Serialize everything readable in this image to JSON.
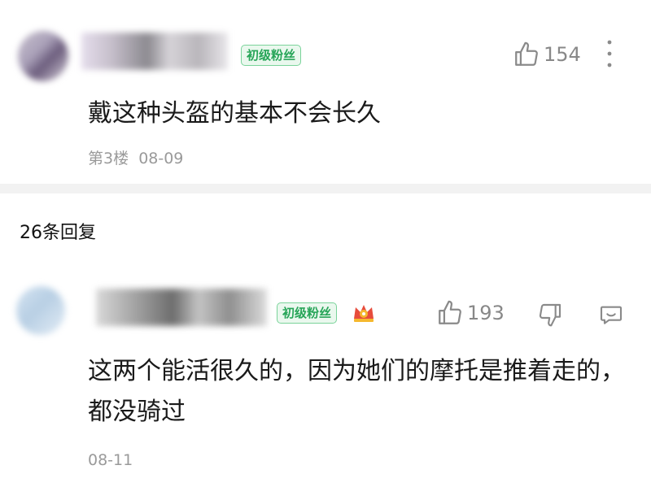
{
  "top_comment": {
    "badge": "初级粉丝",
    "likes": "154",
    "text": "戴这种头盔的基本不会长久",
    "floor": "第3楼",
    "date": "08-09"
  },
  "replies_header": "26条回复",
  "reply": {
    "badge": "初级粉丝",
    "likes": "193",
    "text": "这两个能活很久的，因为她们的摩托是推着走的，都没骑过",
    "date": "08-11"
  },
  "colors": {
    "badge_green": "#27a558",
    "badge_bg": "#eaf8ee",
    "meta_gray": "#9a9a9a",
    "divider": "#f2f2f2"
  },
  "icons": [
    "thumbs-up-icon",
    "more-vertical-icon",
    "crown-badge-icon",
    "thumbs-down-icon",
    "reply-comment-icon"
  ]
}
